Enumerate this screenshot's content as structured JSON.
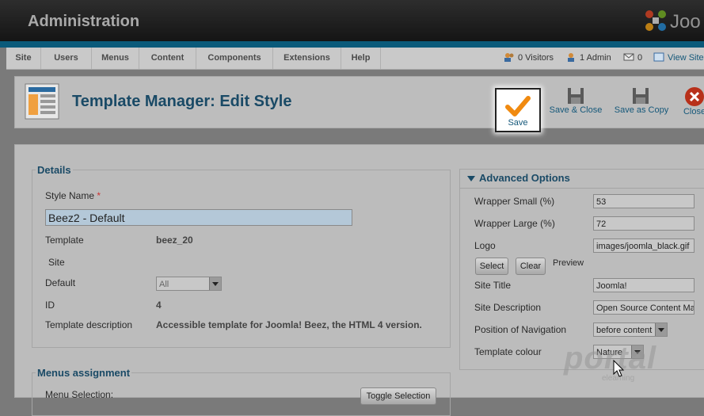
{
  "header": {
    "title": "Administration",
    "brand": "Joo"
  },
  "menu": {
    "items": [
      "Site",
      "Users",
      "Menus",
      "Content",
      "Components",
      "Extensions",
      "Help"
    ],
    "status": {
      "visitors": "0 Visitors",
      "admins": "1 Admin",
      "messages": "0",
      "view_site": "View Site"
    }
  },
  "toolbar": {
    "page_title": "Template Manager: Edit Style",
    "save_label": "Save",
    "save_close_label": "Save & Close",
    "save_copy_label": "Save as Copy",
    "close_label": "Close"
  },
  "details": {
    "legend": "Details",
    "style_name_label": "Style Name",
    "required_mark": "*",
    "style_name_value": "Beez2 - Default",
    "template_label": "Template",
    "template_value": "beez_20",
    "site_label": "Site",
    "default_label": "Default",
    "default_value": "All",
    "id_label": "ID",
    "id_value": "4",
    "description_label": "Template description",
    "description_value": "Accessible template for Joomla! Beez, the HTML 4 version."
  },
  "menus_assignment": {
    "legend": "Menus assignment",
    "menu_selection_label": "Menu Selection:",
    "toggle_button": "Toggle Selection"
  },
  "advanced": {
    "title": "Advanced Options",
    "wrapper_small_label": "Wrapper Small (%)",
    "wrapper_small_value": "53",
    "wrapper_large_label": "Wrapper Large (%)",
    "wrapper_large_value": "72",
    "logo_label": "Logo",
    "logo_value": "images/joomla_black.gif",
    "select_button": "Select",
    "clear_button": "Clear",
    "preview_label": "Preview",
    "site_title_label": "Site Title",
    "site_title_value": "Joomla!",
    "site_description_label": "Site Description",
    "site_description_value": "Open Source Content Man",
    "navigation_label": "Position of Navigation",
    "navigation_value": "before content",
    "colour_label": "Template colour",
    "colour_value": "Nature"
  },
  "watermark": {
    "text": "portal",
    "sub": "elearning"
  },
  "colors": {
    "accent": "#ff8a00",
    "title_blue": "#1a4a66",
    "link_blue": "#15587a",
    "close_red": "#cc2a1a"
  }
}
